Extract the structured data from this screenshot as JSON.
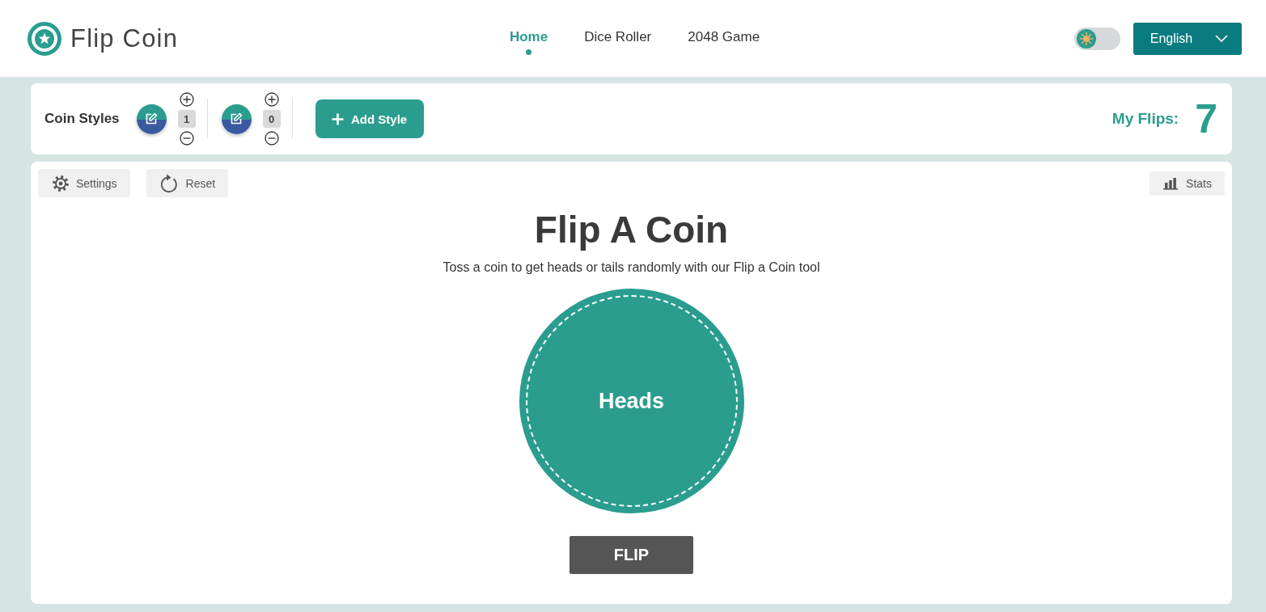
{
  "header": {
    "logo": "Flip Coin",
    "nav": [
      {
        "label": "Home",
        "selected": true
      },
      {
        "label": "Dice Roller",
        "selected": false
      },
      {
        "label": "2048 Game",
        "selected": false
      }
    ],
    "theme_toggle": {
      "on": false
    },
    "language": "English"
  },
  "styles_bar": {
    "label": "Coin Styles",
    "styles": [
      {
        "count": "1"
      },
      {
        "count": "0"
      }
    ],
    "add_button": "Add Style",
    "flips_label": "My Flips:",
    "flips_count": "7"
  },
  "toolbar": {
    "tools": [
      {
        "kind": "settings",
        "label": "Settings"
      },
      {
        "kind": "reset",
        "label": "Reset"
      }
    ],
    "stats": "Stats"
  },
  "main": {
    "title": "Flip A Coin",
    "subtitle": "Toss a coin to get heads or tails randomly with our Flip a Coin tool",
    "coin": {
      "face": "Heads"
    },
    "flip_button": "FLIP"
  }
}
